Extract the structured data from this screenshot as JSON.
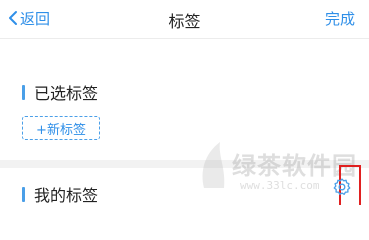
{
  "nav": {
    "back_label": "返回",
    "title": "标签",
    "done_label": "完成"
  },
  "selected_section": {
    "title": "已选标签",
    "add_button_label": "+新标签"
  },
  "my_section": {
    "title": "我的标签"
  },
  "watermark": {
    "text": "绿茶软件园",
    "url": "www.33lc.com"
  },
  "colors": {
    "accent": "#2f8fe8",
    "highlight": "#e02020"
  },
  "icons": {
    "back": "chevron-left-icon",
    "settings": "gear-icon"
  }
}
